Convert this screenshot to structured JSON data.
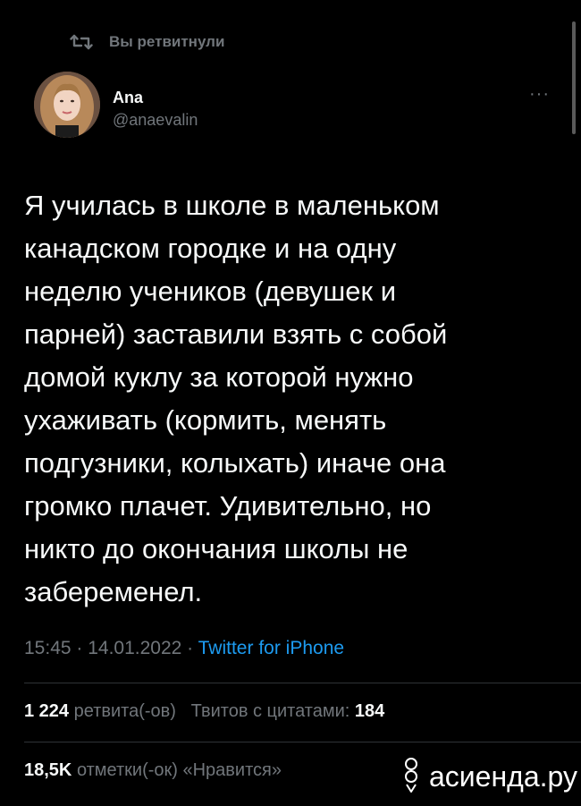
{
  "retweet": {
    "label": "Вы ретвитнули",
    "icon": "retweet-icon"
  },
  "author": {
    "display_name": "Ana",
    "handle": "@anaevalin",
    "avatar_icon": "avatar"
  },
  "more_icon": "ellipsis-icon",
  "more_label": "···",
  "tweet": {
    "text": "Я училась в школе в маленьком\nканадском городке и на одну\nнеделю учеников (девушек и\nпарней) заставили взять с собой\nдомой куклу за которой нужно\nухаживать (кормить, менять\nподгузники, колыхать) иначе она\nгромко плачет. Удивительно, но\nникто до окончания школы не\nзабеременел.",
    "time": "15:45",
    "date": "14.01.2022",
    "separator": " · ",
    "source": "Twitter for iPhone"
  },
  "stats": {
    "retweets_count": "1 224",
    "retweets_label": "ретвита(-ов)",
    "quotes_label": "Твитов с цитатами:",
    "quotes_count": "184",
    "likes_count": "18,5K",
    "likes_label": "отметки(-ок) «Нравится»"
  },
  "watermark": {
    "text": "асиенда.ру",
    "icon": "asienda-logo-icon"
  },
  "colors": {
    "background": "#000000",
    "text": "#f7f9f9",
    "muted": "#71767b",
    "link": "#1d9bf0",
    "divider": "#2f3336"
  }
}
